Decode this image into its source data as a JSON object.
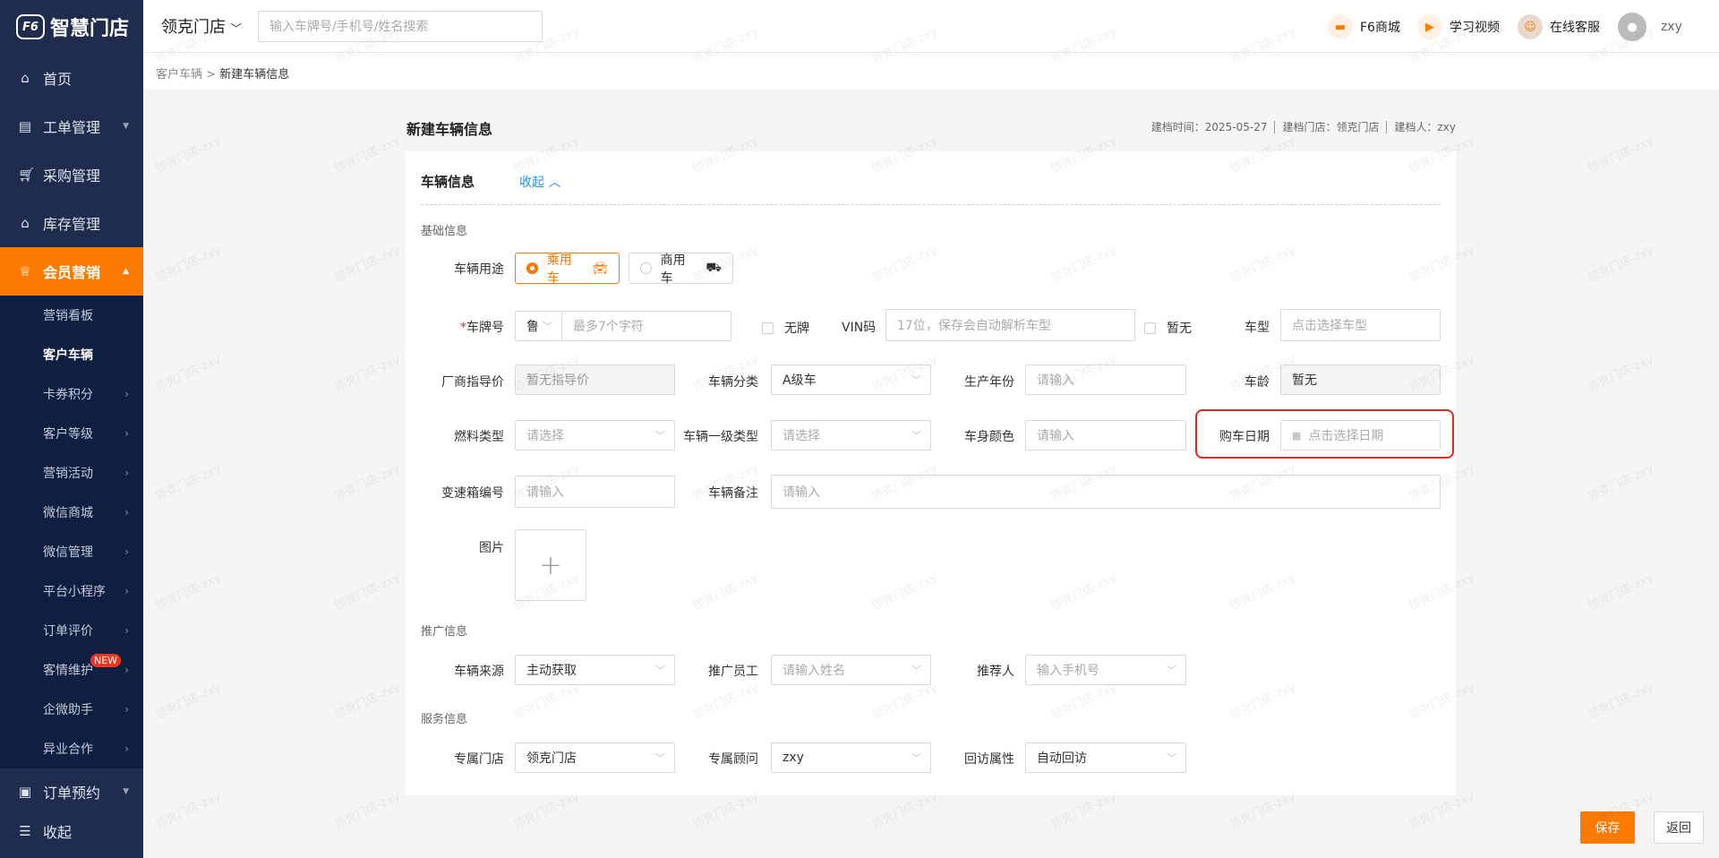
{
  "app": {
    "logo": "智慧门店",
    "logo_mark": "F6"
  },
  "sidebar": {
    "items": [
      {
        "label": "首页",
        "icon": "home-icon"
      },
      {
        "label": "工单管理",
        "icon": "document-icon"
      },
      {
        "label": "采购管理",
        "icon": "cart-icon"
      },
      {
        "label": "库存管理",
        "icon": "warehouse-icon"
      },
      {
        "label": "会员营销",
        "icon": "crown-icon"
      }
    ],
    "submenu": [
      "营销看板",
      "客户车辆",
      "卡券积分",
      "客户等级",
      "营销活动",
      "微信商城",
      "微信管理",
      "平台小程序",
      "订单评价",
      "客情维护",
      "企微助手",
      "异业合作"
    ],
    "new_badge": "NEW",
    "order": "订单预约",
    "collapse": "收起"
  },
  "topbar": {
    "store": "领克门店",
    "search_placeholder": "输入车牌号/手机号/姓名搜索",
    "mall": "F6商城",
    "video": "学习视频",
    "service": "在线客服",
    "user": "zxy"
  },
  "breadcrumb": {
    "parent": "客户车辆",
    "current": "新建车辆信息"
  },
  "page": {
    "title": "新建车辆信息",
    "created_time": "建档时间：2025-05-27",
    "created_store": "建档门店：领克门店",
    "creator": "建档人：zxy"
  },
  "card": {
    "title": "车辆信息",
    "collapse": "收起"
  },
  "basic": {
    "section": "基础信息",
    "usage_label": "车辆用途",
    "usage_options": [
      "乘用车",
      "商用车"
    ],
    "plate_label": "车牌号",
    "plate_prefix": "鲁",
    "plate_placeholder": "最多7个字符",
    "no_plate": "无牌",
    "vin_label": "VIN码",
    "vin_placeholder": "17位，保存会自动解析车型",
    "no_vin": "暂无",
    "model_label": "车型",
    "model_placeholder": "点击选择车型",
    "price_label": "厂商指导价",
    "price_placeholder": "暂无指导价",
    "class_label": "车辆分类",
    "class_value": "A级车",
    "year_label": "生产年份",
    "year_placeholder": "请输入",
    "age_label": "车龄",
    "age_value": "暂无",
    "fuel_label": "燃料类型",
    "fuel_placeholder": "请选择",
    "type_label": "车辆一级类型",
    "type_placeholder": "请选择",
    "color_label": "车身颜色",
    "color_placeholder": "请输入",
    "date_label": "购车日期",
    "date_placeholder": "点击选择日期",
    "gearbox_label": "变速箱编号",
    "gearbox_placeholder": "请输入",
    "remark_label": "车辆备注",
    "remark_placeholder": "请输入",
    "image_label": "图片"
  },
  "promo": {
    "section": "推广信息",
    "source_label": "车辆来源",
    "source_value": "主动获取",
    "staff_label": "推广员工",
    "staff_placeholder": "请输入姓名",
    "referrer_label": "推荐人",
    "referrer_placeholder": "输入手机号"
  },
  "service": {
    "section": "服务信息",
    "store_label": "专属门店",
    "store_value": "领克门店",
    "advisor_label": "专属顾问",
    "advisor_value": "zxy",
    "visit_label": "回访属性",
    "visit_value": "自动回访"
  },
  "actions": {
    "save": "保存",
    "back": "返回"
  },
  "watermark": "领克门店-zxy",
  "colors": {
    "accent": "#ff7a00",
    "sidebar": "#1f2c4e",
    "link": "#1890ff",
    "highlight": "#e8261f"
  }
}
